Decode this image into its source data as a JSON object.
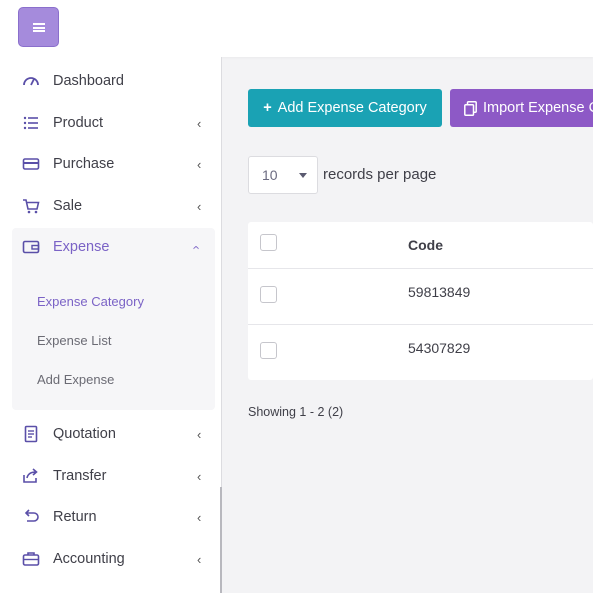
{
  "topbar": {
    "menu_icon": "hamburger-icon"
  },
  "sidebar": {
    "items": [
      {
        "label": "Dashboard",
        "icon": "gauge-icon",
        "has_chevron": false
      },
      {
        "label": "Product",
        "icon": "list-icon",
        "has_chevron": true
      },
      {
        "label": "Purchase",
        "icon": "credit-card-icon",
        "has_chevron": true
      },
      {
        "label": "Sale",
        "icon": "cart-icon",
        "has_chevron": true
      },
      {
        "label": "Expense",
        "icon": "wallet-icon",
        "has_chevron": true,
        "expanded": true
      },
      {
        "label": "Quotation",
        "icon": "document-icon",
        "has_chevron": true
      },
      {
        "label": "Transfer",
        "icon": "share-icon",
        "has_chevron": true
      },
      {
        "label": "Return",
        "icon": "undo-icon",
        "has_chevron": true
      },
      {
        "label": "Accounting",
        "icon": "briefcase-icon",
        "has_chevron": true
      }
    ],
    "expense_sub": [
      {
        "label": "Expense Category",
        "active": true
      },
      {
        "label": "Expense List",
        "active": false
      },
      {
        "label": "Add Expense",
        "active": false
      }
    ],
    "chevron": "‹"
  },
  "toolbar": {
    "add_label": "Add Expense Category",
    "add_icon": "+",
    "import_label": "Import Expense Category",
    "import_icon": "copy-icon",
    "add_color": "#1aa2b4",
    "import_color": "#8d59c6"
  },
  "pagination": {
    "per_page_value": "10",
    "per_page_text": "records per page",
    "showing": "Showing 1 - 2 (2)"
  },
  "table": {
    "header": {
      "code": "Code"
    },
    "rows": [
      {
        "code": "59813849"
      },
      {
        "code": "54307829"
      }
    ]
  },
  "colors": {
    "accent": "#7b63c6",
    "menu_button": "#a58bdc"
  }
}
